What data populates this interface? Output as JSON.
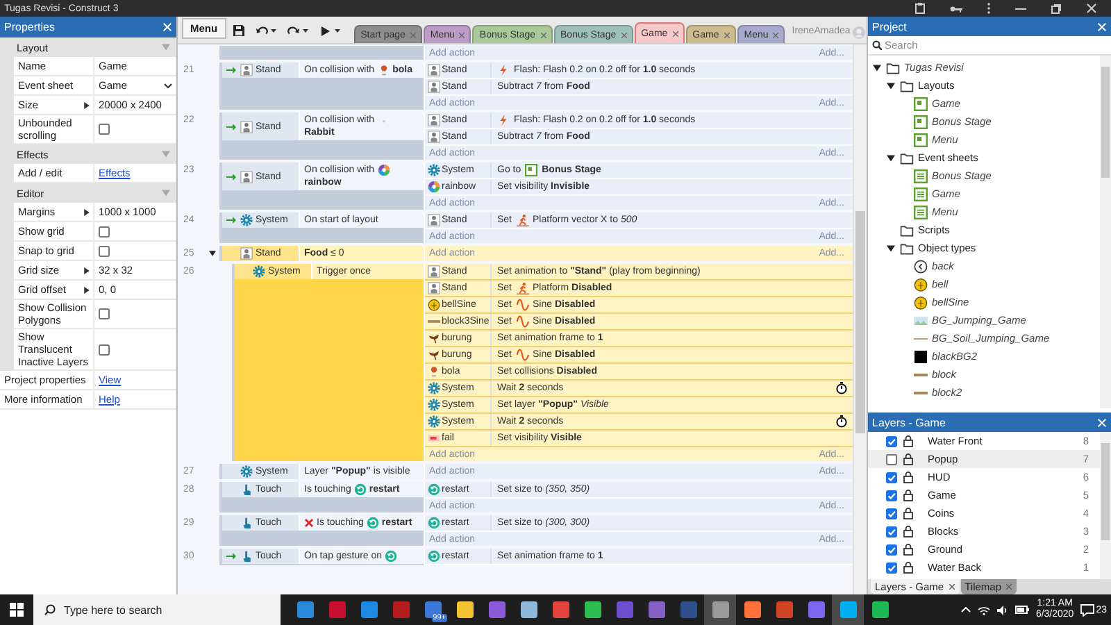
{
  "window": {
    "title": "Tugas Revisi - Construct 3"
  },
  "properties": {
    "title": "Properties",
    "sections": [
      {
        "title": "Layout",
        "expanded": true,
        "rows": [
          {
            "kind": "text",
            "label": "Name",
            "value": "Game",
            "expandable": false
          },
          {
            "kind": "dropdown",
            "label": "Event sheet",
            "value": "Game"
          },
          {
            "kind": "text",
            "label": "Size",
            "value": "20000 x 2400",
            "expandable": true
          },
          {
            "kind": "checkbox",
            "label": "Unbounded scrolling",
            "checked": false
          }
        ]
      },
      {
        "title": "Effects",
        "expanded": true,
        "rows": [
          {
            "kind": "link",
            "label": "Add / edit",
            "value": "Effects"
          }
        ]
      },
      {
        "title": "Editor",
        "expanded": true,
        "rows": [
          {
            "kind": "text",
            "label": "Margins",
            "value": "1000 x 1000",
            "expandable": true
          },
          {
            "kind": "checkbox",
            "label": "Show grid",
            "checked": false
          },
          {
            "kind": "checkbox",
            "label": "Snap to grid",
            "checked": false
          },
          {
            "kind": "text",
            "label": "Grid size",
            "value": "32 x 32",
            "expandable": true
          },
          {
            "kind": "text",
            "label": "Grid offset",
            "value": "0, 0",
            "expandable": true
          },
          {
            "kind": "checkbox",
            "label": "Show Collision Polygons",
            "checked": false
          },
          {
            "kind": "checkbox",
            "label": "Show Translucent Inactive Layers",
            "checked": false
          }
        ]
      }
    ],
    "footer": [
      {
        "label": "Project properties",
        "link": "View"
      },
      {
        "label": "More information",
        "link": "Help"
      }
    ]
  },
  "toolbar": {
    "menu": "Menu",
    "tabs": [
      {
        "label": "Start page",
        "color": "#8e8e8e",
        "selected": false
      },
      {
        "label": "Menu",
        "color": "#bb9cc6",
        "selected": false
      },
      {
        "label": "Bonus Stage",
        "color": "#a9c99a",
        "selected": false
      },
      {
        "label": "Bonus Stage",
        "color": "#9fc0b9",
        "selected": false
      },
      {
        "label": "Game",
        "color": "#f7c9c9",
        "selected": true
      },
      {
        "label": "Game",
        "color": "#cbbb8f",
        "selected": false
      },
      {
        "label": "Menu",
        "color": "#a7a9cd",
        "selected": false
      }
    ],
    "user": "IreneAmadea"
  },
  "event_sheet": {
    "top_fragment": {
      "add_action": "Add action",
      "add_more": "Add..."
    },
    "events": [
      {
        "number": "21",
        "trigger": true,
        "selected": false,
        "conditions": [
          {
            "object": "Stand",
            "kind": "sprite",
            "text": "On collision with",
            "target": {
              "kind": "ball",
              "name": "bola"
            }
          }
        ],
        "actions": [
          {
            "object": "Stand",
            "kind": "sprite",
            "behavior": {
              "kind": "flash"
            },
            "text": "Flash: Flash 0.2 on 0.2 off for **1.0** seconds"
          },
          {
            "object": "Stand",
            "kind": "sprite",
            "text": "Subtract *7* from **Food**"
          }
        ],
        "add_action": "Add action",
        "add_more": "Add..."
      },
      {
        "number": "22",
        "trigger": true,
        "selected": false,
        "conditions": [
          {
            "object": "Stand",
            "kind": "sprite",
            "text": "On collision with",
            "target": {
              "kind": "blank",
              "name": "Rabbit"
            }
          }
        ],
        "actions": [
          {
            "object": "Stand",
            "kind": "sprite",
            "behavior": {
              "kind": "flash"
            },
            "text": "Flash: Flash 0.2 on 0.2 off for **1.0** seconds"
          },
          {
            "object": "Stand",
            "kind": "sprite",
            "text": "Subtract *7* from **Food**"
          }
        ],
        "add_action": "Add action",
        "add_more": "Add..."
      },
      {
        "number": "23",
        "trigger": true,
        "selected": false,
        "conditions": [
          {
            "object": "Stand",
            "kind": "sprite",
            "text": "On collision with",
            "target": {
              "kind": "rainbow",
              "name": "rainbow"
            }
          }
        ],
        "actions": [
          {
            "object": "System",
            "kind": "gear",
            "prefix": "Go to",
            "behavior": {
              "kind": "layout"
            },
            "text": "**Bonus Stage**"
          },
          {
            "object": "rainbow",
            "kind": "rainbow",
            "text": "Set visibility **Invisible**"
          }
        ],
        "add_action": "Add action",
        "add_more": "Add..."
      },
      {
        "number": "24",
        "trigger": true,
        "selected": false,
        "conditions": [
          {
            "object": "System",
            "kind": "gear",
            "text": "On start of layout"
          }
        ],
        "actions": [
          {
            "object": "Stand",
            "kind": "sprite",
            "prefix": "Set",
            "behavior": {
              "kind": "platform"
            },
            "text": "Platform vector X to *500*"
          }
        ],
        "add_action": "Add action",
        "add_more": "Add..."
      },
      {
        "number": "25",
        "trigger": false,
        "selected": true,
        "expanded": true,
        "conditions": [
          {
            "object": "Stand",
            "kind": "sprite",
            "text": "**Food** ≤ 0"
          }
        ],
        "add_action": "Add action",
        "add_more": "Add...",
        "children": [
          {
            "number": "26",
            "trigger": false,
            "selected": true,
            "conditions": [
              {
                "object": "System",
                "kind": "gear",
                "text": "Trigger once"
              }
            ],
            "actions": [
              {
                "object": "Stand",
                "kind": "sprite",
                "text": "Set animation to **\"Stand\"** (play from beginning)"
              },
              {
                "object": "Stand",
                "kind": "sprite",
                "prefix": "Set",
                "behavior": {
                  "kind": "platform"
                },
                "text": "Platform **Disabled**"
              },
              {
                "object": "bellSine",
                "kind": "bell",
                "prefix": "Set",
                "behavior": {
                  "kind": "sine"
                },
                "text": "Sine **Disabled**"
              },
              {
                "object": "block3Sine",
                "kind": "bar",
                "prefix": "Set",
                "behavior": {
                  "kind": "sine"
                },
                "text": "Sine **Disabled**"
              },
              {
                "object": "burung",
                "kind": "bird",
                "text": "Set animation frame to **1**"
              },
              {
                "object": "burung",
                "kind": "bird",
                "prefix": "Set",
                "behavior": {
                  "kind": "sine"
                },
                "text": "Sine **Disabled**"
              },
              {
                "object": "bola",
                "kind": "ball",
                "text": "Set collisions **Disabled**"
              },
              {
                "object": "System",
                "kind": "gear",
                "text": "Wait **2** seconds",
                "wait": true
              },
              {
                "object": "System",
                "kind": "gear",
                "text": "Set layer **\"Popup\"** *Visible*"
              },
              {
                "object": "System",
                "kind": "gear",
                "text": "Wait **2** seconds",
                "wait": true
              },
              {
                "object": "fail",
                "kind": "label",
                "text": "Set visibility **Visible**"
              }
            ],
            "add_action": "Add action",
            "add_more": "Add..."
          }
        ]
      },
      {
        "number": "27",
        "trigger": false,
        "selected": false,
        "conditions": [
          {
            "object": "System",
            "kind": "gear",
            "text": "Layer **\"Popup\"** is visible"
          }
        ],
        "add_action": "Add action",
        "add_more": "Add..."
      },
      {
        "number": "28",
        "trigger": false,
        "selected": false,
        "conditions": [
          {
            "object": "Touch",
            "kind": "touch",
            "text": "Is touching",
            "target": {
              "kind": "restart",
              "name": "restart"
            }
          }
        ],
        "actions": [
          {
            "object": "restart",
            "kind": "restart",
            "text": "Set size to *(350, 350)*"
          }
        ],
        "add_action": "Add action",
        "add_more": "Add..."
      },
      {
        "number": "29",
        "trigger": false,
        "selected": false,
        "conditions": [
          {
            "object": "Touch",
            "kind": "touch",
            "inverted": true,
            "text": "Is touching",
            "target": {
              "kind": "restart",
              "name": "restart"
            }
          }
        ],
        "actions": [
          {
            "object": "restart",
            "kind": "restart",
            "text": "Set size to *(300, 300)*"
          }
        ],
        "add_action": "Add action",
        "add_more": "Add..."
      },
      {
        "number": "30",
        "trigger": true,
        "selected": false,
        "conditions": [
          {
            "object": "Touch",
            "kind": "touch",
            "text": "On tap gesture on",
            "target": {
              "kind": "restart"
            }
          }
        ],
        "actions": [
          {
            "object": "restart",
            "kind": "restart",
            "text": "Set animation frame to **1**"
          }
        ]
      }
    ]
  },
  "project": {
    "title": "Project",
    "search_placeholder": "Search",
    "tree": [
      {
        "label": "Tugas Revisi",
        "kind": "folder",
        "expanded": true,
        "children": [
          {
            "label": "Layouts",
            "kind": "folder",
            "expanded": true,
            "children": [
              {
                "label": "Game",
                "kind": "layout"
              },
              {
                "label": "Bonus Stage",
                "kind": "layout"
              },
              {
                "label": "Menu",
                "kind": "layout"
              }
            ]
          },
          {
            "label": "Event sheets",
            "kind": "folder",
            "expanded": true,
            "children": [
              {
                "label": "Bonus Stage",
                "kind": "sheet"
              },
              {
                "label": "Game",
                "kind": "sheet"
              },
              {
                "label": "Menu",
                "kind": "sheet"
              }
            ]
          },
          {
            "label": "Scripts",
            "kind": "folder"
          },
          {
            "label": "Object types",
            "kind": "folder",
            "expanded": true,
            "children": [
              {
                "label": "back",
                "kind": "back"
              },
              {
                "label": "bell",
                "kind": "bell"
              },
              {
                "label": "bellSine",
                "kind": "bell"
              },
              {
                "label": "BG_Jumping_Game",
                "kind": "bg"
              },
              {
                "label": "BG_Soil_Jumping_Game",
                "kind": "line"
              },
              {
                "label": "blackBG2",
                "kind": "black"
              },
              {
                "label": "block",
                "kind": "bar"
              },
              {
                "label": "block2",
                "kind": "bar"
              }
            ]
          }
        ]
      }
    ]
  },
  "layers": {
    "title": "Layers - Game",
    "layers": [
      {
        "name": "Water Front",
        "number": "8",
        "visible": true,
        "selected": false
      },
      {
        "name": "Popup",
        "number": "7",
        "visible": false,
        "selected": true
      },
      {
        "name": "HUD",
        "number": "6",
        "visible": true,
        "selected": false
      },
      {
        "name": "Game",
        "number": "5",
        "visible": true,
        "selected": false
      },
      {
        "name": "Coins",
        "number": "4",
        "visible": true,
        "selected": false
      },
      {
        "name": "Blocks",
        "number": "3",
        "visible": true,
        "selected": false
      },
      {
        "name": "Ground",
        "number": "2",
        "visible": true,
        "selected": false
      },
      {
        "name": "Water Back",
        "number": "1",
        "visible": true,
        "selected": false
      }
    ],
    "tabs": [
      {
        "label": "Layers - Game",
        "selected": true
      },
      {
        "label": "Tilemap",
        "selected": false
      }
    ]
  },
  "taskbar": {
    "search_placeholder": "Type here to search",
    "apps": [
      {
        "color": "#2b88d8",
        "active": false
      },
      {
        "color": "#c8102e",
        "active": false
      },
      {
        "color": "#1e88e5",
        "active": false
      },
      {
        "color": "#b71c1c",
        "active": false
      },
      {
        "color": "#3b78d8",
        "active": false,
        "badge": "99+"
      },
      {
        "color": "#f4c430",
        "active": false
      },
      {
        "color": "#8e5bd8",
        "active": false
      },
      {
        "color": "#8fb8d8",
        "active": false
      },
      {
        "color": "#e0443a",
        "active": false
      },
      {
        "color": "#2ebd4f",
        "active": false
      },
      {
        "color": "#6e4fd0",
        "active": false
      },
      {
        "color": "#8661c5",
        "active": false
      },
      {
        "color": "#2d4f8a",
        "active": false
      },
      {
        "color": "#9a9a9a",
        "active": true
      },
      {
        "color": "#ff7139",
        "active": false
      },
      {
        "color": "#d04423",
        "active": false
      },
      {
        "color": "#7b68ee",
        "active": false
      },
      {
        "color": "#00aff0",
        "active": true
      },
      {
        "color": "#1db954",
        "active": false
      }
    ],
    "time": "1:21 AM",
    "date": "6/3/2020",
    "notifications": "23"
  }
}
